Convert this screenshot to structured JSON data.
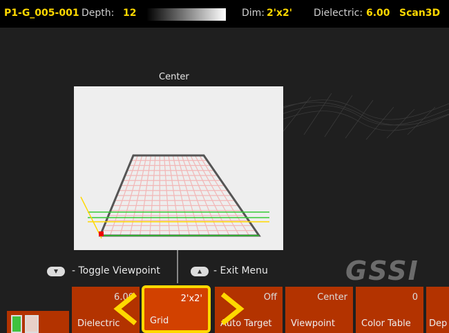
{
  "status_bar": {
    "filename": "P1-G_005-001",
    "depth_label": "Depth:",
    "depth_value": "12",
    "dim_label": "Dim:",
    "dim_value": "2'x2'",
    "dielectric_label": "Dielectric:",
    "dielectric_value": "6.00",
    "mode": "Scan3D"
  },
  "viewport": {
    "title": "Center"
  },
  "hints": {
    "toggle": "- Toggle Viewpoint",
    "exit": "- Exit Menu"
  },
  "logo": "GSSI",
  "softkeys": [
    {
      "label": "Dielectric",
      "value": "6.00"
    },
    {
      "label": "Grid",
      "value": "2'x2'",
      "selected": true
    },
    {
      "label": "Auto Target",
      "value": "Off"
    },
    {
      "label": "Viewpoint",
      "value": "Center"
    },
    {
      "label": "Color Table",
      "value": "0"
    },
    {
      "label": "Dep",
      "value": ""
    }
  ],
  "icons": {
    "left_arrow": "chevron-left-icon",
    "right_arrow": "chevron-right-icon",
    "down_key": "arrow-down-key-icon",
    "up_key": "arrow-up-key-icon",
    "battery": "battery-icon"
  },
  "colors": {
    "accent": "#ffd800",
    "softkey": "#b33300",
    "softkey_selected": "#d24100",
    "grid_line": "#f4b8b8",
    "grid_frame": "#555555"
  }
}
